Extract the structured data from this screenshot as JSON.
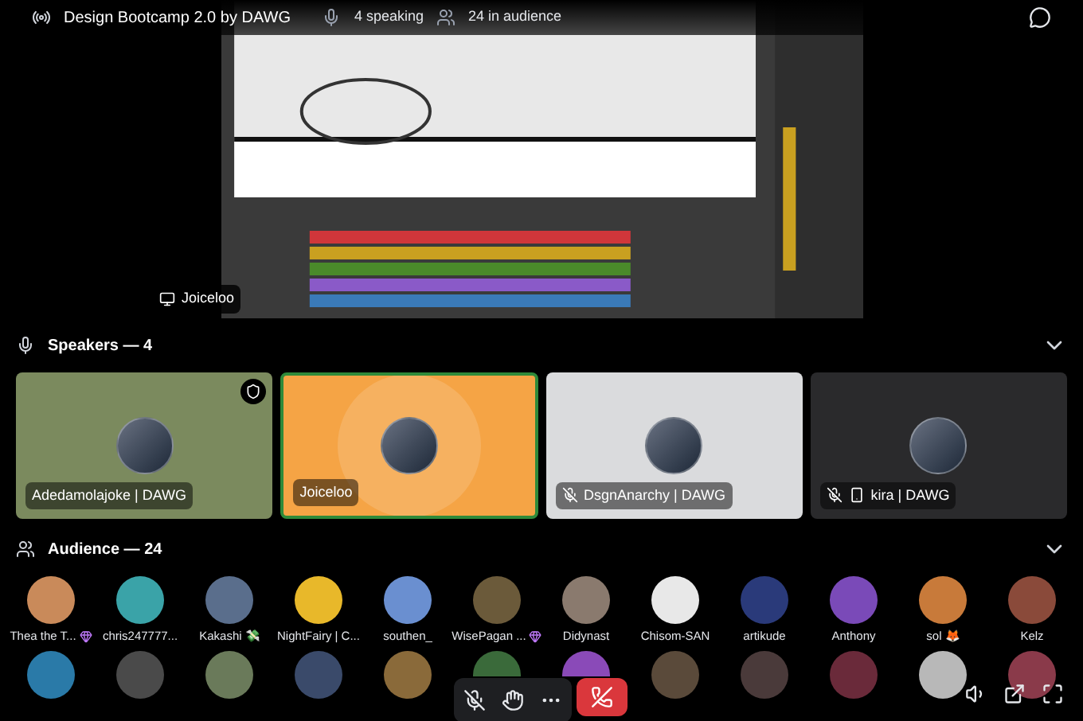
{
  "header": {
    "title": "Design Bootcamp 2.0 by DAWG",
    "speaking": "4 speaking",
    "audience": "24 in audience"
  },
  "stream": {
    "owner": "Joiceloo"
  },
  "speakers": {
    "heading": "Speakers — 4",
    "expanded": true,
    "tiles": [
      {
        "name": "Adedamolajoke | DAWG",
        "speaking": false,
        "muted": false,
        "mobile": false,
        "moderator": true,
        "color": "#7b8a5e"
      },
      {
        "name": "Joiceloo",
        "speaking": true,
        "muted": false,
        "mobile": false,
        "moderator": false,
        "color": "#f5a445"
      },
      {
        "name": "DsgnAnarchy | DAWG",
        "speaking": false,
        "muted": true,
        "mobile": false,
        "moderator": false,
        "color": "#dadbdd"
      },
      {
        "name": "kira | DAWG",
        "speaking": false,
        "muted": true,
        "mobile": true,
        "moderator": false,
        "color": "#2a2a2c"
      }
    ]
  },
  "audience": {
    "heading": "Audience — 24",
    "expanded": true,
    "members": [
      {
        "name": "Thea the T...",
        "badge": true,
        "color": "#c98a5a"
      },
      {
        "name": "chris247777...",
        "badge": false,
        "color": "#3aa3a8"
      },
      {
        "name": "Kakashi 💸",
        "badge": false,
        "color": "#5a6e8c"
      },
      {
        "name": "NightFairy | C...",
        "badge": false,
        "color": "#e8b82a"
      },
      {
        "name": "southen_",
        "badge": false,
        "color": "#6a8fd0"
      },
      {
        "name": "WisePagan ...",
        "badge": true,
        "color": "#6b5a3a"
      },
      {
        "name": "Didynast",
        "badge": false,
        "color": "#8a7a6e"
      },
      {
        "name": "Chisom-SAN",
        "badge": false,
        "color": "#e8e8e8"
      },
      {
        "name": "artikude",
        "badge": false,
        "color": "#2a3a7a"
      },
      {
        "name": "Anthony",
        "badge": false,
        "color": "#7a4ab8"
      },
      {
        "name": "sol 🦊",
        "badge": false,
        "color": "#c87a3a"
      },
      {
        "name": "Kelz",
        "badge": false,
        "color": "#8a4a3a"
      }
    ],
    "more": [
      {
        "color": "#2a7aa8"
      },
      {
        "color": "#4a4a4a"
      },
      {
        "color": "#6a7a5a"
      },
      {
        "color": "#3a4a6a"
      },
      {
        "color": "#8a6a3a"
      },
      {
        "color": "#3a6a3a"
      },
      {
        "color": "#8a4ab8"
      },
      {
        "color": "#5a4a3a"
      },
      {
        "color": "#4a3a3a"
      },
      {
        "color": "#6a2a3a"
      },
      {
        "color": "#b8b8b8"
      },
      {
        "color": "#8a3a4a"
      }
    ]
  },
  "controls": {
    "muted": true
  }
}
